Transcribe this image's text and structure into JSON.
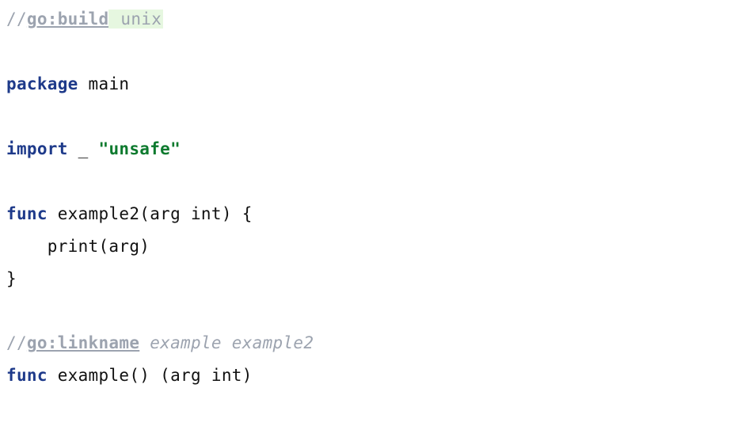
{
  "code": {
    "line1": {
      "slash": "//",
      "directive": "go:build",
      "arg": " unix"
    },
    "line3": {
      "keyword": "package",
      "rest": " main"
    },
    "line5": {
      "keyword": "import",
      "mid": " _ ",
      "string": "\"unsafe\""
    },
    "line7": {
      "keyword": "func",
      "rest": " example2(arg int) {"
    },
    "line8": {
      "text": "    print(arg)"
    },
    "line9": {
      "text": "}"
    },
    "line11": {
      "slash": "//",
      "directive": "go:linkname",
      "args": " example example2"
    },
    "line12": {
      "keyword": "func",
      "rest": " example() (arg int)"
    }
  }
}
